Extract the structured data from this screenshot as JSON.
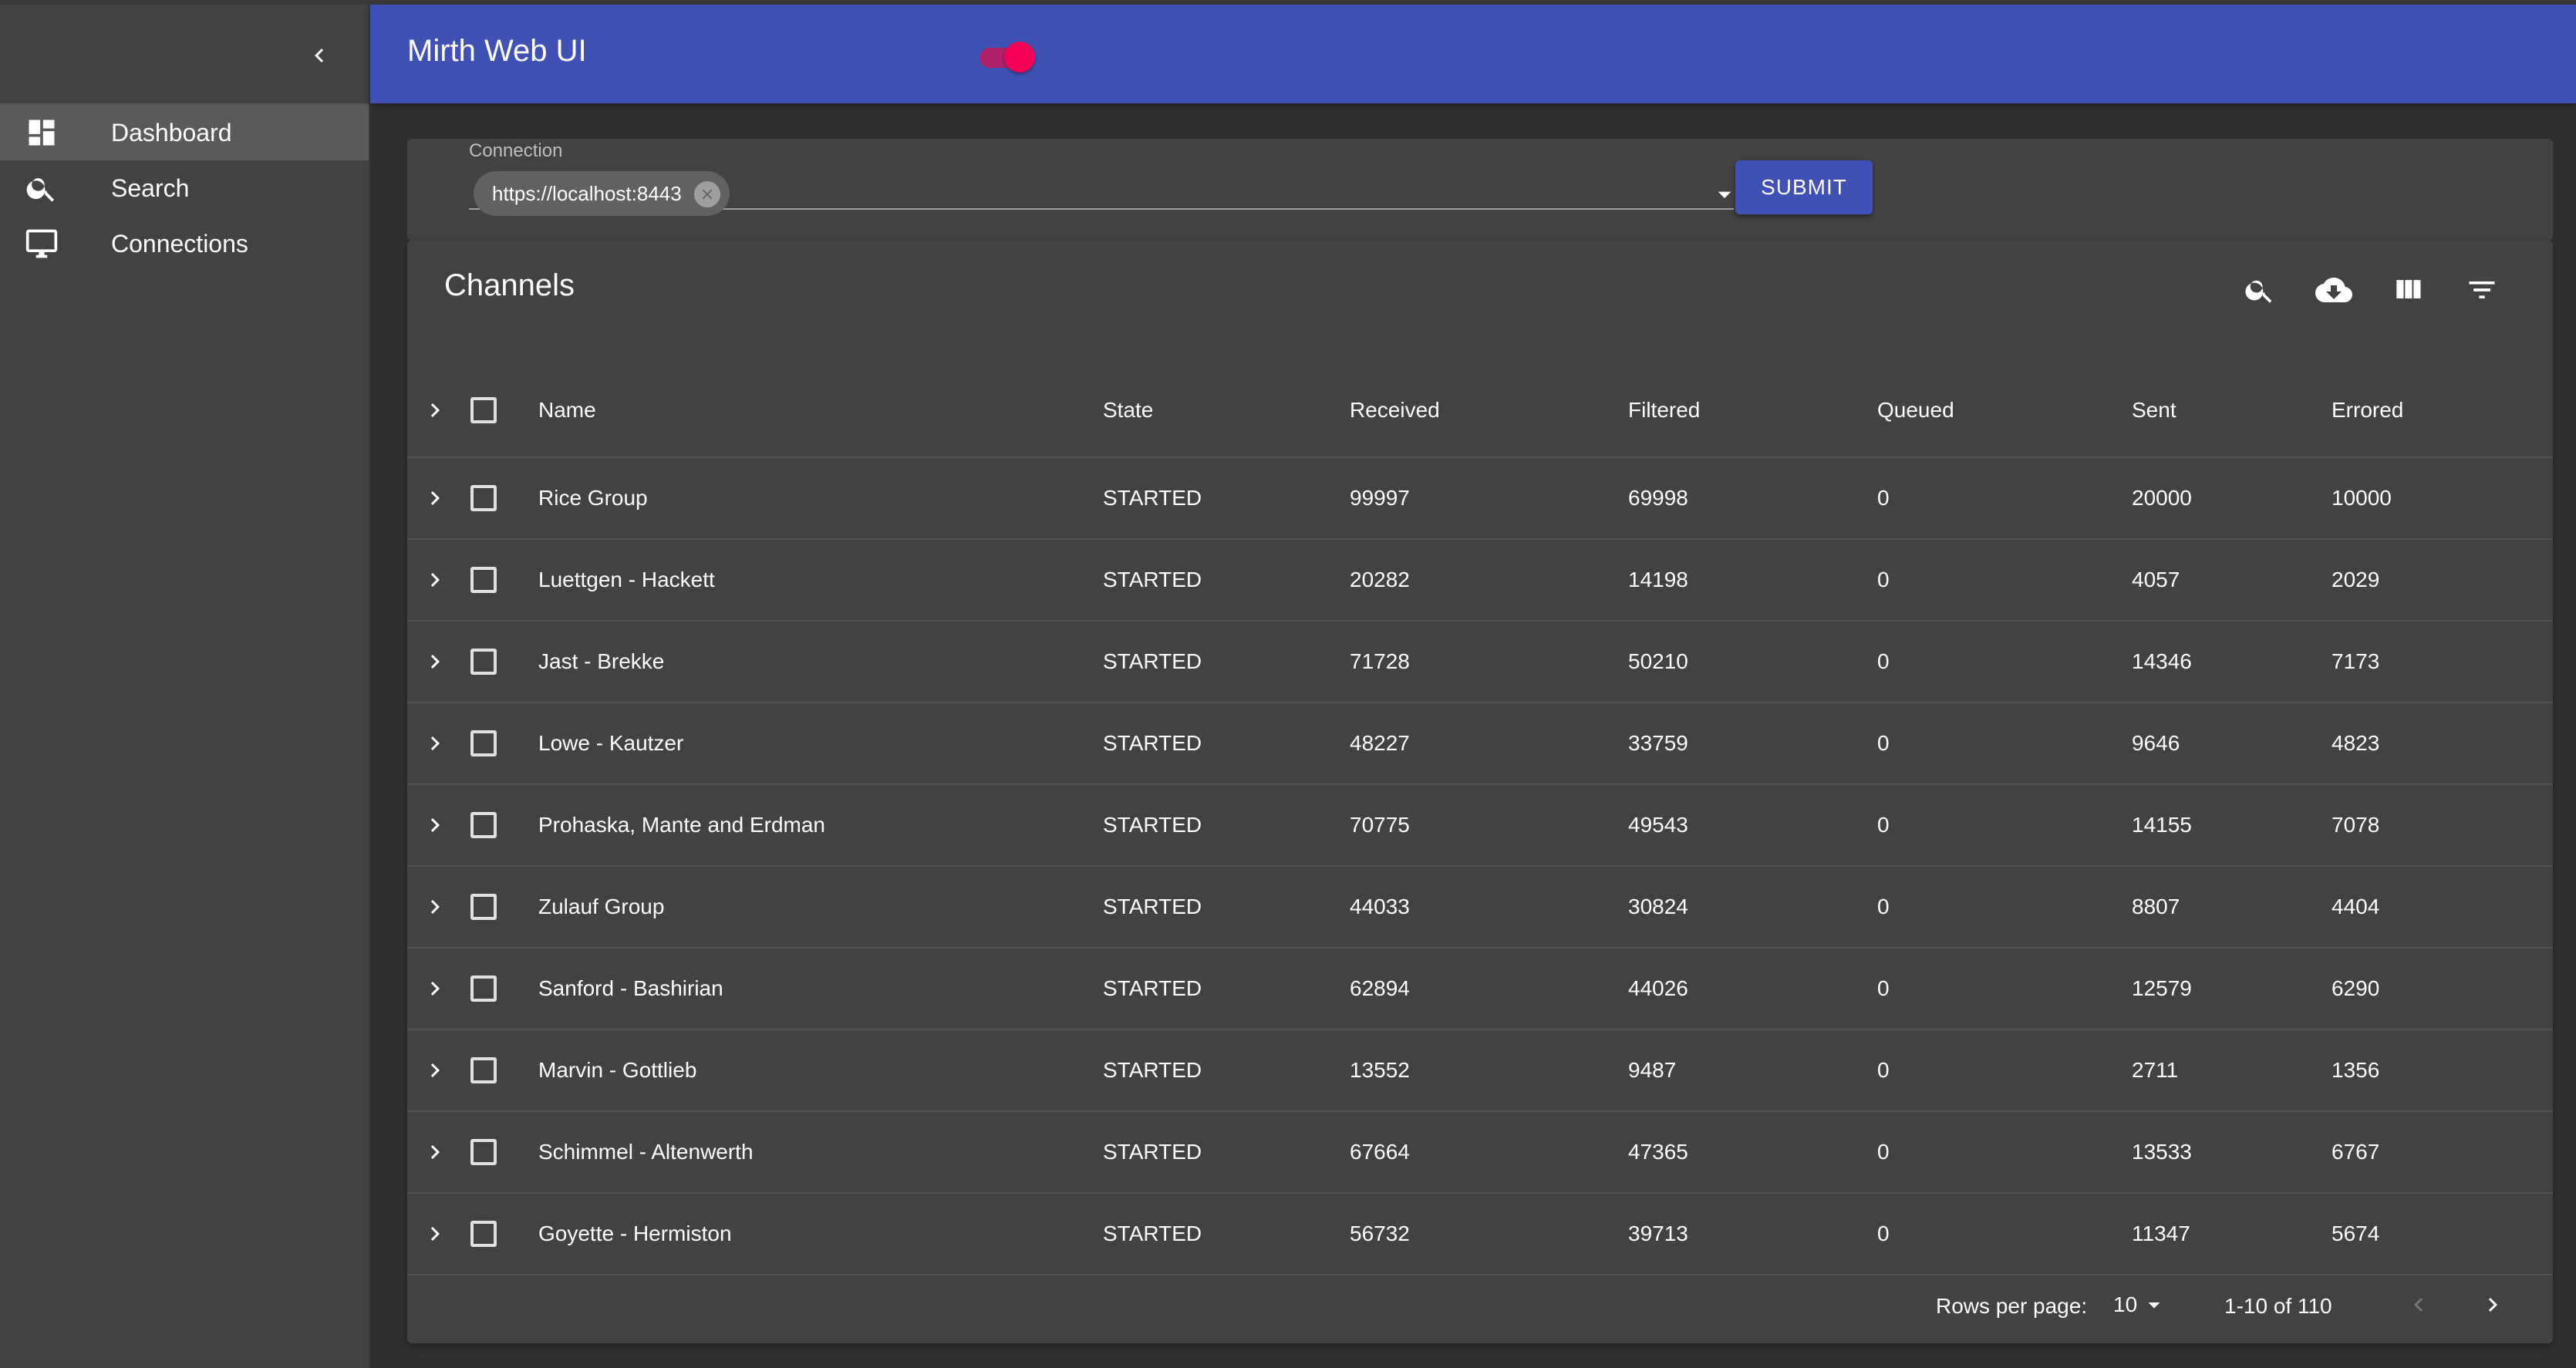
{
  "app": {
    "title": "Mirth Web UI",
    "theme_toggle_on": true
  },
  "sidebar": {
    "collapse_icon": "chevron-left-icon",
    "items": [
      {
        "label": "Dashboard",
        "icon": "dashboard-icon",
        "active": true
      },
      {
        "label": "Search",
        "icon": "search-icon",
        "active": false
      },
      {
        "label": "Connections",
        "icon": "monitor-icon",
        "active": false
      }
    ]
  },
  "connection": {
    "label": "Connection",
    "selected": "https://localhost:8443",
    "submit_label": "SUBMIT"
  },
  "channels": {
    "title": "Channels",
    "toolbar_icons": [
      "search-icon",
      "cloud-download-icon",
      "view-columns-icon",
      "filter-list-icon"
    ],
    "columns": [
      "Name",
      "State",
      "Received",
      "Filtered",
      "Queued",
      "Sent",
      "Errored"
    ],
    "rows": [
      {
        "name": "Rice Group",
        "state": "STARTED",
        "received": "99997",
        "filtered": "69998",
        "queued": "0",
        "sent": "20000",
        "errored": "10000"
      },
      {
        "name": "Luettgen - Hackett",
        "state": "STARTED",
        "received": "20282",
        "filtered": "14198",
        "queued": "0",
        "sent": "4057",
        "errored": "2029"
      },
      {
        "name": "Jast - Brekke",
        "state": "STARTED",
        "received": "71728",
        "filtered": "50210",
        "queued": "0",
        "sent": "14346",
        "errored": "7173"
      },
      {
        "name": "Lowe - Kautzer",
        "state": "STARTED",
        "received": "48227",
        "filtered": "33759",
        "queued": "0",
        "sent": "9646",
        "errored": "4823"
      },
      {
        "name": "Prohaska, Mante and Erdman",
        "state": "STARTED",
        "received": "70775",
        "filtered": "49543",
        "queued": "0",
        "sent": "14155",
        "errored": "7078"
      },
      {
        "name": "Zulauf Group",
        "state": "STARTED",
        "received": "44033",
        "filtered": "30824",
        "queued": "0",
        "sent": "8807",
        "errored": "4404"
      },
      {
        "name": "Sanford - Bashirian",
        "state": "STARTED",
        "received": "62894",
        "filtered": "44026",
        "queued": "0",
        "sent": "12579",
        "errored": "6290"
      },
      {
        "name": "Marvin - Gottlieb",
        "state": "STARTED",
        "received": "13552",
        "filtered": "9487",
        "queued": "0",
        "sent": "2711",
        "errored": "1356"
      },
      {
        "name": "Schimmel - Altenwerth",
        "state": "STARTED",
        "received": "67664",
        "filtered": "47365",
        "queued": "0",
        "sent": "13533",
        "errored": "6767"
      },
      {
        "name": "Goyette - Hermiston",
        "state": "STARTED",
        "received": "56732",
        "filtered": "39713",
        "queued": "0",
        "sent": "11347",
        "errored": "5674"
      }
    ],
    "pagination": {
      "rows_per_page_label": "Rows per page:",
      "rows_per_page": "10",
      "range": "1-10 of 110"
    }
  },
  "colors": {
    "primary": "#3f51b5",
    "secondary": "#f50057",
    "background": "#303030",
    "surface": "#424242"
  }
}
